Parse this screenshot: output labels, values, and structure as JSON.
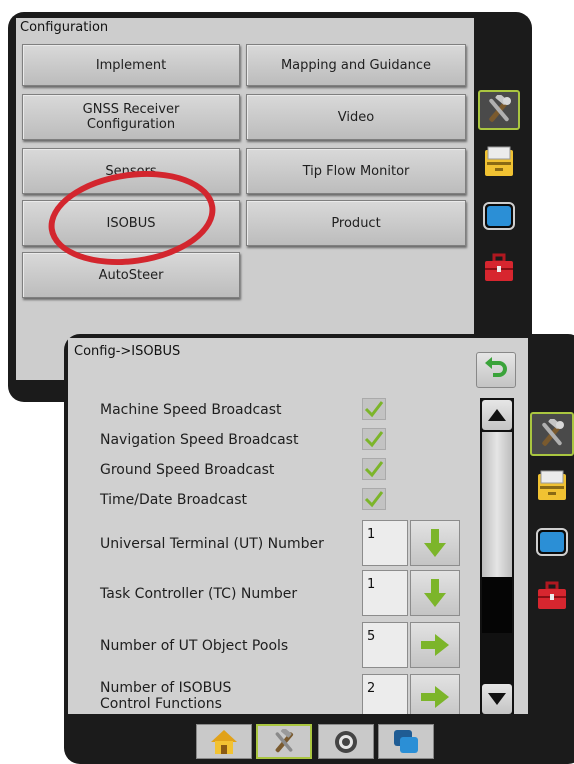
{
  "config": {
    "title": "Configuration",
    "buttons": [
      "Implement",
      "Mapping and Guidance",
      "GNSS Receiver\nConfiguration",
      "Video",
      "Sensors",
      "Tip Flow Monitor",
      "ISOBUS",
      "Product",
      "AutoSteer"
    ]
  },
  "isobus": {
    "title": "Config->ISOBUS",
    "broadcasts": [
      {
        "label": "Machine Speed Broadcast",
        "checked": true
      },
      {
        "label": "Navigation Speed Broadcast",
        "checked": true
      },
      {
        "label": "Ground Speed Broadcast",
        "checked": true
      },
      {
        "label": "Time/Date Broadcast",
        "checked": true
      }
    ],
    "settings": [
      {
        "label": "Universal Terminal (UT) Number",
        "value": "1",
        "arrow": "down"
      },
      {
        "label": "Task Controller (TC) Number",
        "value": "1",
        "arrow": "down"
      },
      {
        "label": "Number of UT Object Pools",
        "value": "5",
        "arrow": "right"
      },
      {
        "label": "Number of ISOBUS\nControl Functions",
        "value": "2",
        "arrow": "right"
      }
    ],
    "scroll_position": 0.72
  },
  "side_icons": [
    "tools-icon",
    "console-icon",
    "screen-icon",
    "toolbox-icon"
  ],
  "bottom_tabs": [
    "home-icon",
    "tools-icon",
    "target-icon",
    "layers-icon"
  ],
  "colors": {
    "accent_green": "#7cb52a",
    "annotation_red": "#d3262e",
    "selected_border": "#aac640"
  }
}
